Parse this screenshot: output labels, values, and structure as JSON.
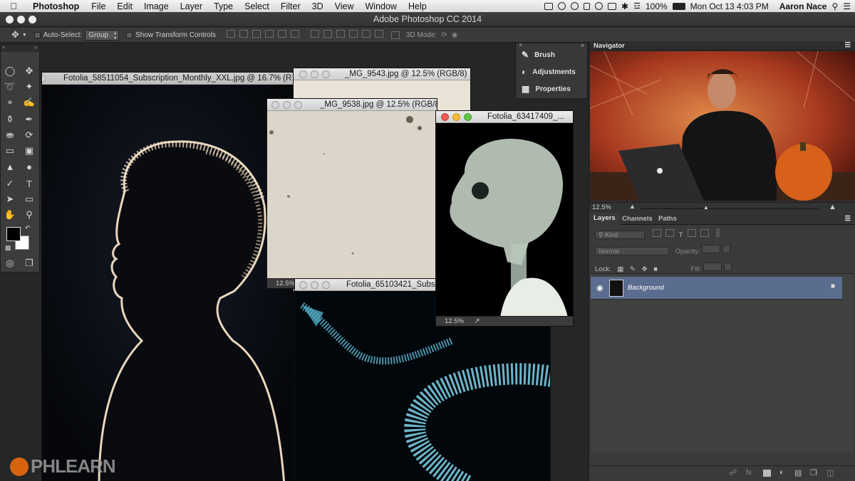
{
  "menubar": {
    "app_name": "Photoshop",
    "menus": [
      "File",
      "Edit",
      "Image",
      "Layer",
      "Type",
      "Select",
      "Filter",
      "3D",
      "View",
      "Window",
      "Help"
    ],
    "battery": "100%",
    "datetime": "Mon Oct 13  4:03 PM",
    "user": "Aaron Nace"
  },
  "window_title": "Adobe Photoshop CC 2014",
  "options_bar": {
    "auto_select_label": "Auto-Select:",
    "auto_select_value": "Group",
    "show_transform_label": "Show Transform Controls",
    "mode_3d_label": "3D Mode:"
  },
  "documents": {
    "main": {
      "title": "Fotolia_58511054_Subscription_Monthly_XXL.jpg @ 16.7% (R"
    },
    "mg9543": {
      "title": "_MG_9543.jpg @ 12.5% (RGB/8)"
    },
    "mg9538": {
      "title": "_MG_9538.jpg @ 12.5% (RGB/8)",
      "zoom": "12.5%"
    },
    "skull": {
      "title": "Fotolia_63417409_...",
      "zoom": "12.5%"
    },
    "snake": {
      "title": "Fotolia_65103421_Subs"
    }
  },
  "mini_panel": {
    "items": [
      {
        "label": "Brush",
        "icon": "brush-icon"
      },
      {
        "label": "Adjustments",
        "icon": "adjustments-icon"
      },
      {
        "label": "Properties",
        "icon": "properties-icon"
      }
    ]
  },
  "navigator": {
    "tab": "Navigator",
    "zoom": "12.5%"
  },
  "layers_panel": {
    "tabs": [
      "Layers",
      "Channels",
      "Paths"
    ],
    "filter_kind": "Kind",
    "blend_mode": "Normal",
    "opacity_label": "Opacity:",
    "lock_label": "Lock:",
    "fill_label": "Fill:",
    "layers": [
      {
        "name": "Background",
        "visible": true,
        "locked": true
      }
    ]
  },
  "watermark": "PHLEARN",
  "colors": {
    "accent_layer": "#5a6d8e",
    "panel_bg": "#3a3a3a",
    "doc_area_bg": "#262626"
  }
}
